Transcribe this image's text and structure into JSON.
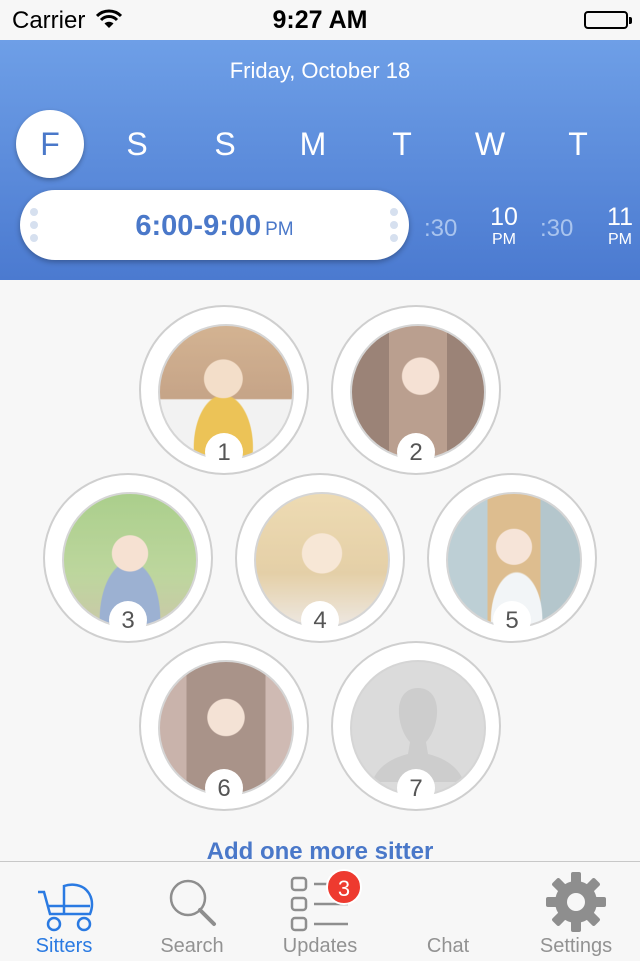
{
  "status_bar": {
    "carrier": "Carrier",
    "time": "9:27 AM"
  },
  "header": {
    "date": "Friday, October 18",
    "days": [
      {
        "letter": "F",
        "selected": true
      },
      {
        "letter": "S",
        "selected": false
      },
      {
        "letter": "S",
        "selected": false
      },
      {
        "letter": "M",
        "selected": false
      },
      {
        "letter": "T",
        "selected": false
      },
      {
        "letter": "W",
        "selected": false
      },
      {
        "letter": "T",
        "selected": false
      }
    ],
    "time_range": {
      "range": "6:00-9:00",
      "suffix": "PM"
    },
    "timeline": [
      {
        "label": ":30"
      },
      {
        "hour": "10",
        "ampm": "PM"
      },
      {
        "label": ":30"
      },
      {
        "hour": "11",
        "ampm": "PM"
      }
    ]
  },
  "sitters": [
    {
      "number": "1",
      "photo": "sitter-photo"
    },
    {
      "number": "2",
      "photo": "sitter-photo"
    },
    {
      "number": "3",
      "photo": "sitter-photo"
    },
    {
      "number": "4",
      "photo": "sitter-photo"
    },
    {
      "number": "5",
      "photo": "sitter-photo"
    },
    {
      "number": "6",
      "photo": "sitter-photo"
    },
    {
      "number": "7",
      "photo": "placeholder-silhouette"
    }
  ],
  "add_sitter_label": "Add one more sitter",
  "tab_bar": {
    "tabs": [
      {
        "label": "Sitters",
        "icon": "stroller-icon",
        "active": true
      },
      {
        "label": "Search",
        "icon": "search-icon",
        "active": false
      },
      {
        "label": "Updates",
        "icon": "list-icon",
        "active": false,
        "badge": "3"
      },
      {
        "label": "Chat",
        "icon": "chat-icon",
        "active": false
      },
      {
        "label": "Settings",
        "icon": "gear-icon",
        "active": false
      }
    ]
  },
  "colors": {
    "accent": "#4a78c9",
    "tab_active": "#2a7ae2",
    "badge": "#ee3a2f",
    "header_top": "#6e9fe7",
    "header_bottom": "#4b7ad0"
  }
}
